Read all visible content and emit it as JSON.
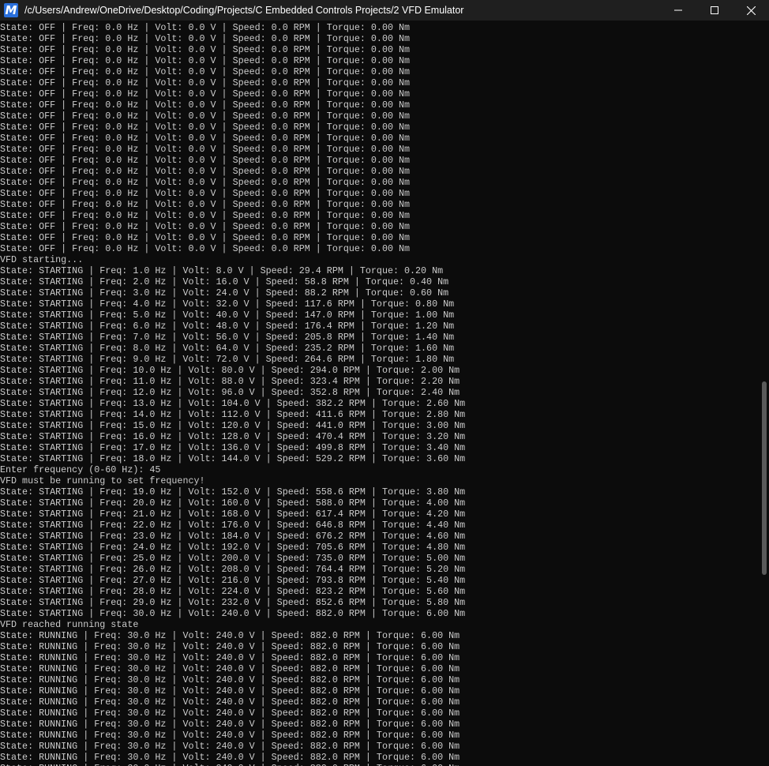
{
  "window": {
    "title": "/c/Users/Andrew/OneDrive/Desktop/Coding/Projects/C Embedded Controls Projects/2 VFD Emulator",
    "app_icon_letter": "M",
    "icons": {
      "app": "msys-icon",
      "minimize": "minimize-icon",
      "maximize": "maximize-icon",
      "close": "close-icon"
    }
  },
  "terminal": {
    "lines": [
      "State: OFF | Freq: 0.0 Hz | Volt: 0.0 V | Speed: 0.0 RPM | Torque: 0.00 Nm",
      "State: OFF | Freq: 0.0 Hz | Volt: 0.0 V | Speed: 0.0 RPM | Torque: 0.00 Nm",
      "State: OFF | Freq: 0.0 Hz | Volt: 0.0 V | Speed: 0.0 RPM | Torque: 0.00 Nm",
      "State: OFF | Freq: 0.0 Hz | Volt: 0.0 V | Speed: 0.0 RPM | Torque: 0.00 Nm",
      "State: OFF | Freq: 0.0 Hz | Volt: 0.0 V | Speed: 0.0 RPM | Torque: 0.00 Nm",
      "State: OFF | Freq: 0.0 Hz | Volt: 0.0 V | Speed: 0.0 RPM | Torque: 0.00 Nm",
      "State: OFF | Freq: 0.0 Hz | Volt: 0.0 V | Speed: 0.0 RPM | Torque: 0.00 Nm",
      "State: OFF | Freq: 0.0 Hz | Volt: 0.0 V | Speed: 0.0 RPM | Torque: 0.00 Nm",
      "State: OFF | Freq: 0.0 Hz | Volt: 0.0 V | Speed: 0.0 RPM | Torque: 0.00 Nm",
      "State: OFF | Freq: 0.0 Hz | Volt: 0.0 V | Speed: 0.0 RPM | Torque: 0.00 Nm",
      "State: OFF | Freq: 0.0 Hz | Volt: 0.0 V | Speed: 0.0 RPM | Torque: 0.00 Nm",
      "State: OFF | Freq: 0.0 Hz | Volt: 0.0 V | Speed: 0.0 RPM | Torque: 0.00 Nm",
      "State: OFF | Freq: 0.0 Hz | Volt: 0.0 V | Speed: 0.0 RPM | Torque: 0.00 Nm",
      "State: OFF | Freq: 0.0 Hz | Volt: 0.0 V | Speed: 0.0 RPM | Torque: 0.00 Nm",
      "State: OFF | Freq: 0.0 Hz | Volt: 0.0 V | Speed: 0.0 RPM | Torque: 0.00 Nm",
      "State: OFF | Freq: 0.0 Hz | Volt: 0.0 V | Speed: 0.0 RPM | Torque: 0.00 Nm",
      "State: OFF | Freq: 0.0 Hz | Volt: 0.0 V | Speed: 0.0 RPM | Torque: 0.00 Nm",
      "State: OFF | Freq: 0.0 Hz | Volt: 0.0 V | Speed: 0.0 RPM | Torque: 0.00 Nm",
      "State: OFF | Freq: 0.0 Hz | Volt: 0.0 V | Speed: 0.0 RPM | Torque: 0.00 Nm",
      "State: OFF | Freq: 0.0 Hz | Volt: 0.0 V | Speed: 0.0 RPM | Torque: 0.00 Nm",
      "State: OFF | Freq: 0.0 Hz | Volt: 0.0 V | Speed: 0.0 RPM | Torque: 0.00 Nm",
      "VFD starting...",
      "State: STARTING | Freq: 1.0 Hz | Volt: 8.0 V | Speed: 29.4 RPM | Torque: 0.20 Nm",
      "State: STARTING | Freq: 2.0 Hz | Volt: 16.0 V | Speed: 58.8 RPM | Torque: 0.40 Nm",
      "State: STARTING | Freq: 3.0 Hz | Volt: 24.0 V | Speed: 88.2 RPM | Torque: 0.60 Nm",
      "State: STARTING | Freq: 4.0 Hz | Volt: 32.0 V | Speed: 117.6 RPM | Torque: 0.80 Nm",
      "State: STARTING | Freq: 5.0 Hz | Volt: 40.0 V | Speed: 147.0 RPM | Torque: 1.00 Nm",
      "State: STARTING | Freq: 6.0 Hz | Volt: 48.0 V | Speed: 176.4 RPM | Torque: 1.20 Nm",
      "State: STARTING | Freq: 7.0 Hz | Volt: 56.0 V | Speed: 205.8 RPM | Torque: 1.40 Nm",
      "State: STARTING | Freq: 8.0 Hz | Volt: 64.0 V | Speed: 235.2 RPM | Torque: 1.60 Nm",
      "State: STARTING | Freq: 9.0 Hz | Volt: 72.0 V | Speed: 264.6 RPM | Torque: 1.80 Nm",
      "State: STARTING | Freq: 10.0 Hz | Volt: 80.0 V | Speed: 294.0 RPM | Torque: 2.00 Nm",
      "State: STARTING | Freq: 11.0 Hz | Volt: 88.0 V | Speed: 323.4 RPM | Torque: 2.20 Nm",
      "State: STARTING | Freq: 12.0 Hz | Volt: 96.0 V | Speed: 352.8 RPM | Torque: 2.40 Nm",
      "State: STARTING | Freq: 13.0 Hz | Volt: 104.0 V | Speed: 382.2 RPM | Torque: 2.60 Nm",
      "State: STARTING | Freq: 14.0 Hz | Volt: 112.0 V | Speed: 411.6 RPM | Torque: 2.80 Nm",
      "State: STARTING | Freq: 15.0 Hz | Volt: 120.0 V | Speed: 441.0 RPM | Torque: 3.00 Nm",
      "State: STARTING | Freq: 16.0 Hz | Volt: 128.0 V | Speed: 470.4 RPM | Torque: 3.20 Nm",
      "State: STARTING | Freq: 17.0 Hz | Volt: 136.0 V | Speed: 499.8 RPM | Torque: 3.40 Nm",
      "State: STARTING | Freq: 18.0 Hz | Volt: 144.0 V | Speed: 529.2 RPM | Torque: 3.60 Nm",
      "Enter frequency (0-60 Hz): 45",
      "VFD must be running to set frequency!",
      "State: STARTING | Freq: 19.0 Hz | Volt: 152.0 V | Speed: 558.6 RPM | Torque: 3.80 Nm",
      "State: STARTING | Freq: 20.0 Hz | Volt: 160.0 V | Speed: 588.0 RPM | Torque: 4.00 Nm",
      "State: STARTING | Freq: 21.0 Hz | Volt: 168.0 V | Speed: 617.4 RPM | Torque: 4.20 Nm",
      "State: STARTING | Freq: 22.0 Hz | Volt: 176.0 V | Speed: 646.8 RPM | Torque: 4.40 Nm",
      "State: STARTING | Freq: 23.0 Hz | Volt: 184.0 V | Speed: 676.2 RPM | Torque: 4.60 Nm",
      "State: STARTING | Freq: 24.0 Hz | Volt: 192.0 V | Speed: 705.6 RPM | Torque: 4.80 Nm",
      "State: STARTING | Freq: 25.0 Hz | Volt: 200.0 V | Speed: 735.0 RPM | Torque: 5.00 Nm",
      "State: STARTING | Freq: 26.0 Hz | Volt: 208.0 V | Speed: 764.4 RPM | Torque: 5.20 Nm",
      "State: STARTING | Freq: 27.0 Hz | Volt: 216.0 V | Speed: 793.8 RPM | Torque: 5.40 Nm",
      "State: STARTING | Freq: 28.0 Hz | Volt: 224.0 V | Speed: 823.2 RPM | Torque: 5.60 Nm",
      "State: STARTING | Freq: 29.0 Hz | Volt: 232.0 V | Speed: 852.6 RPM | Torque: 5.80 Nm",
      "State: STARTING | Freq: 30.0 Hz | Volt: 240.0 V | Speed: 882.0 RPM | Torque: 6.00 Nm",
      "VFD reached running state",
      "State: RUNNING | Freq: 30.0 Hz | Volt: 240.0 V | Speed: 882.0 RPM | Torque: 6.00 Nm",
      "State: RUNNING | Freq: 30.0 Hz | Volt: 240.0 V | Speed: 882.0 RPM | Torque: 6.00 Nm",
      "State: RUNNING | Freq: 30.0 Hz | Volt: 240.0 V | Speed: 882.0 RPM | Torque: 6.00 Nm",
      "State: RUNNING | Freq: 30.0 Hz | Volt: 240.0 V | Speed: 882.0 RPM | Torque: 6.00 Nm",
      "State: RUNNING | Freq: 30.0 Hz | Volt: 240.0 V | Speed: 882.0 RPM | Torque: 6.00 Nm",
      "State: RUNNING | Freq: 30.0 Hz | Volt: 240.0 V | Speed: 882.0 RPM | Torque: 6.00 Nm",
      "State: RUNNING | Freq: 30.0 Hz | Volt: 240.0 V | Speed: 882.0 RPM | Torque: 6.00 Nm",
      "State: RUNNING | Freq: 30.0 Hz | Volt: 240.0 V | Speed: 882.0 RPM | Torque: 6.00 Nm",
      "State: RUNNING | Freq: 30.0 Hz | Volt: 240.0 V | Speed: 882.0 RPM | Torque: 6.00 Nm",
      "State: RUNNING | Freq: 30.0 Hz | Volt: 240.0 V | Speed: 882.0 RPM | Torque: 6.00 Nm",
      "State: RUNNING | Freq: 30.0 Hz | Volt: 240.0 V | Speed: 882.0 RPM | Torque: 6.00 Nm",
      "State: RUNNING | Freq: 30.0 Hz | Volt: 240.0 V | Speed: 882.0 RPM | Torque: 6.00 Nm",
      "State: RUNNING | Freq: 30.0 Hz | Volt: 240.0 V | Speed: 882.0 RPM | Torque: 6.00 Nm"
    ]
  },
  "colors": {
    "background": "#0c0c0c",
    "titlebar": "#1f1f1f",
    "text": "#cccccc",
    "accent": "#2a6fdb"
  }
}
